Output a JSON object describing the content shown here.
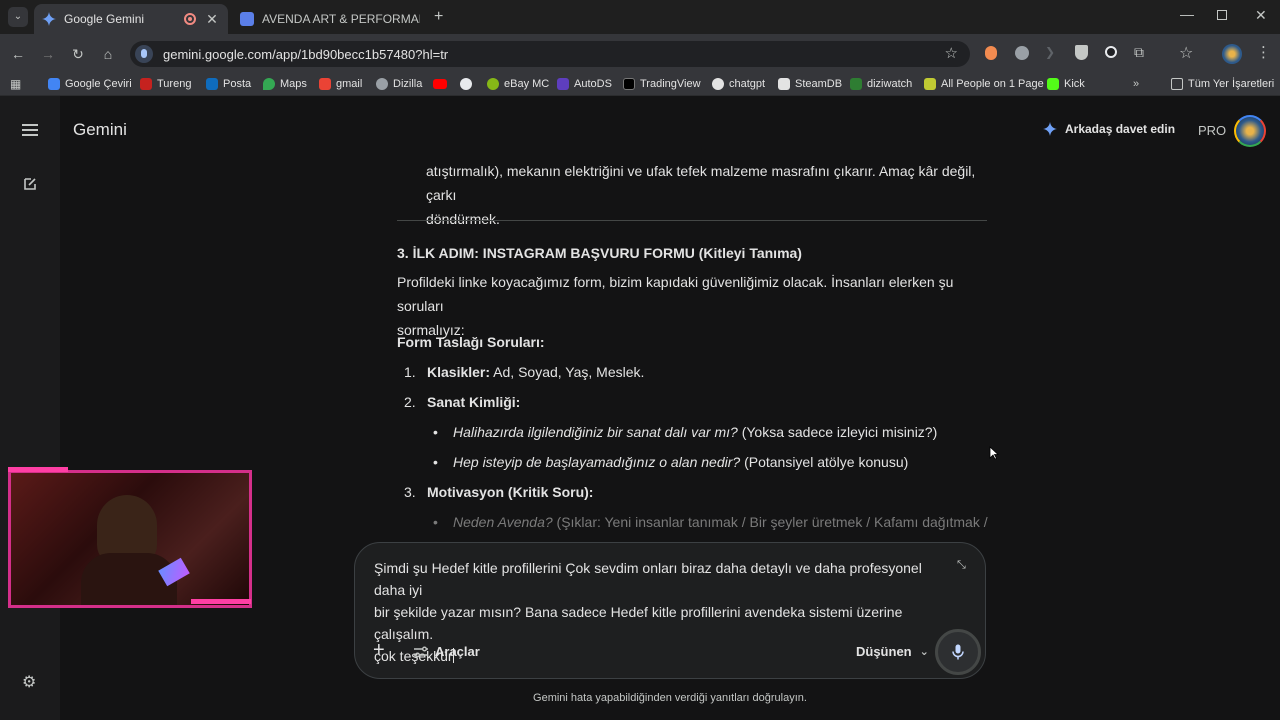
{
  "browser": {
    "tabs": [
      {
        "title": "Google Gemini",
        "active": true
      },
      {
        "title": "AVENDA ART & PERFORMANCE",
        "active": false
      }
    ],
    "url": "gemini.google.com/app/1bd90becc1b57480?hl=tr",
    "bookmarks": [
      {
        "label": "Google Çeviri"
      },
      {
        "label": "Tureng"
      },
      {
        "label": "Posta"
      },
      {
        "label": "Maps"
      },
      {
        "label": "gmail"
      },
      {
        "label": "Dizilla"
      },
      {
        "label": "eBay MC"
      },
      {
        "label": "AutoDS"
      },
      {
        "label": "TradingView"
      },
      {
        "label": "chatgpt"
      },
      {
        "label": "SteamDB"
      },
      {
        "label": "diziwatch"
      },
      {
        "label": "All People on 1 Page"
      },
      {
        "label": "Kick"
      }
    ],
    "all_bookmarks": "Tüm Yer İşaretleri"
  },
  "app": {
    "title": "Gemini",
    "invite": "Arkadaş davet edin",
    "pro": "PRO"
  },
  "content": {
    "para_top_1": "atıştırmalık), mekanın elektriğini ve ufak tefek malzeme masrafını çıkarır. Amaç kâr değil, çarkı",
    "para_top_2": "döndürmek.",
    "section_heading": "3. İLK ADIM: INSTAGRAM BAŞVURU FORMU (Kitleyi Tanıma)",
    "intro_1": "Profildeki linke koyacağımız form, bizim kapıdaki güvenliğimiz olacak. İnsanları elerken şu soruları",
    "intro_2": "sormalıyız:",
    "form_heading": "Form Taslağı Soruları:",
    "item1_num": "1.",
    "item1_bold": "Klasikler:",
    "item1_text": " Ad, Soyad, Yaş, Meslek.",
    "item2_num": "2.",
    "item2_bold": "Sanat Kimliği:",
    "item2_b1_italic": "Halihazırda ilgilendiğiniz bir sanat dalı var mı?",
    "item2_b1_text": " (Yoksa sadece izleyici misiniz?)",
    "item2_b2_italic": "Hep isteyip de başlayamadığınız o alan nedir?",
    "item2_b2_text": " (Potansiyel atölye konusu)",
    "item3_num": "3.",
    "item3_bold": "Motivasyon (Kritik Soru):",
    "item3_b1_italic": "Neden Avenda?",
    "item3_b1_text": " (Şıklar: Yeni insanlar tanımak / Bir şeyler üretmek / Kafamı dağıtmak /"
  },
  "input": {
    "line1": "Şimdi şu Hedef kitle profillerini Çok sevdim onları biraz daha detaylı ve daha profesyonel daha iyi",
    "line2": "bir şekilde yazar mısın? Bana sadece Hedef kitle profillerini avendeka sistemi üzerine çalışalım.",
    "line3": "çok teşekkür",
    "tools": "Araçlar",
    "model": "Düşünen"
  },
  "footer": "Gemini hata yapabildiğinden verdiği yanıtları doğrulayın."
}
